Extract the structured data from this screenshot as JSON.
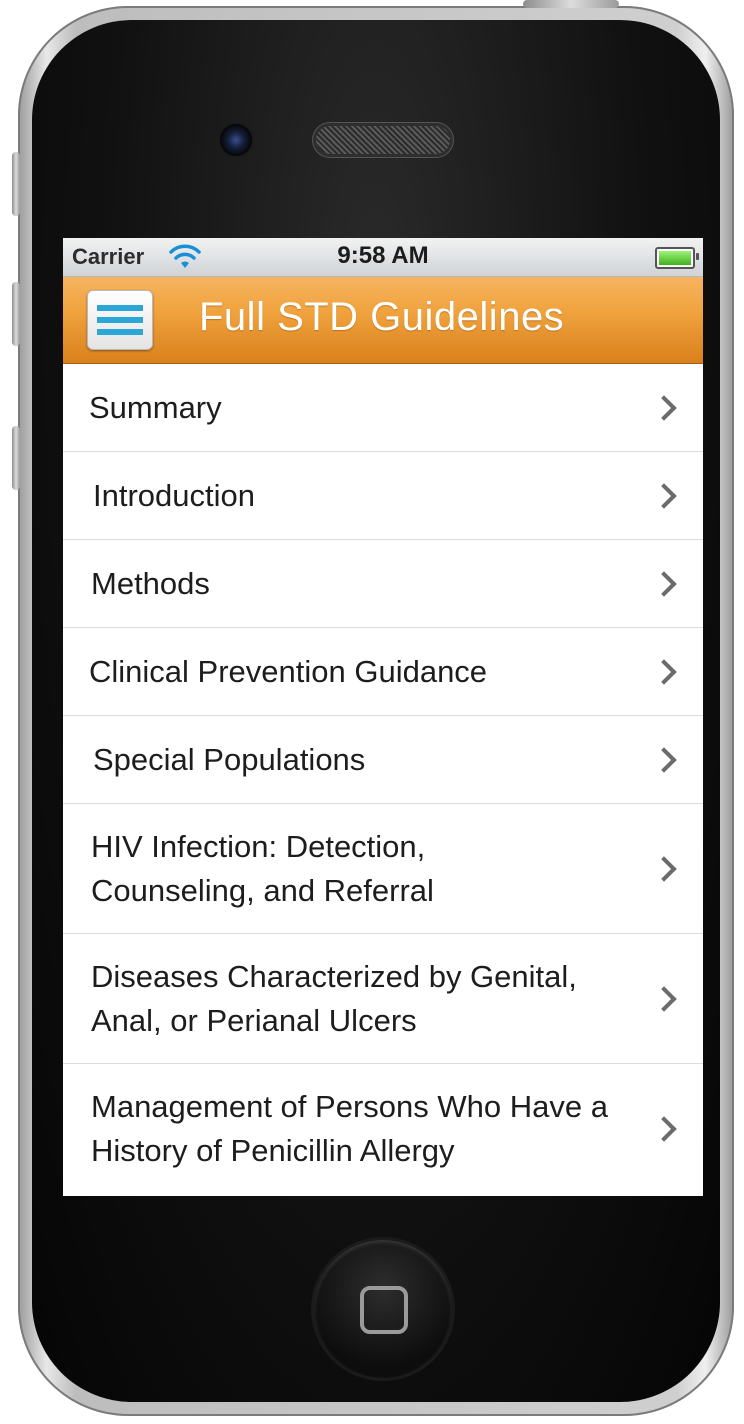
{
  "status_bar": {
    "carrier": "Carrier",
    "time": "9:58 AM",
    "battery_level": 1.0
  },
  "nav_bar": {
    "title": "Full STD Guidelines",
    "menu_icon": "hamburger-menu-icon",
    "accent_color": "#f0a33e",
    "title_color": "#ffffff"
  },
  "list": {
    "items": [
      {
        "label": "Summary"
      },
      {
        "label": "Introduction"
      },
      {
        "label": "Methods"
      },
      {
        "label": "Clinical Prevention Guidance"
      },
      {
        "label": "Special Populations"
      },
      {
        "label": "HIV Infection: Detection, Counseling, and Referral"
      },
      {
        "label": "Diseases Characterized by Genital, Anal, or Perianal Ulcers"
      },
      {
        "label": "Management of Persons Who Have a History of Penicillin Allergy"
      }
    ]
  }
}
